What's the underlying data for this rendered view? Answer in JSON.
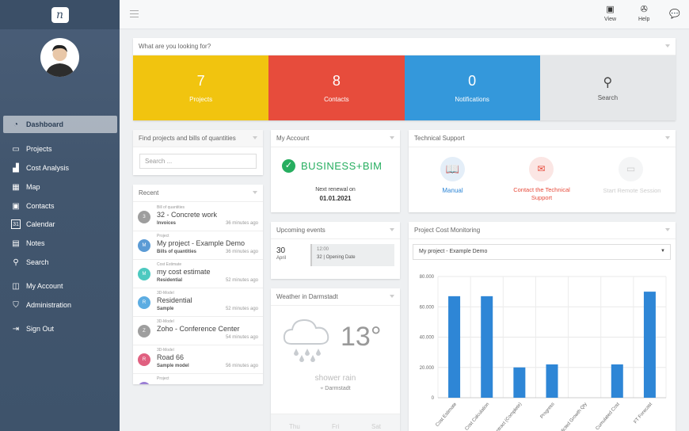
{
  "topbar": {
    "view_label": "View",
    "help_label": "Help"
  },
  "sidebar": {
    "logo": "n",
    "items": [
      {
        "label": "Dashboard",
        "icon": "speedometer-icon",
        "glyph": "◔"
      },
      {
        "label": "Projects",
        "icon": "folder-icon",
        "glyph": "▭"
      },
      {
        "label": "Cost Analysis",
        "icon": "bar-chart-icon",
        "glyph": "▟"
      },
      {
        "label": "Map",
        "icon": "map-icon",
        "glyph": "▦"
      },
      {
        "label": "Contacts",
        "icon": "contacts-icon",
        "glyph": "▣"
      },
      {
        "label": "Calendar",
        "icon": "calendar-icon",
        "glyph": "31"
      },
      {
        "label": "Notes",
        "icon": "notes-icon",
        "glyph": "▤"
      },
      {
        "label": "Search",
        "icon": "search-icon",
        "glyph": "⚲"
      },
      {
        "label": "My Account",
        "icon": "account-icon",
        "glyph": "◫"
      },
      {
        "label": "Administration",
        "icon": "shield-icon",
        "glyph": "⛉"
      },
      {
        "label": "Sign Out",
        "icon": "sign-out-icon",
        "glyph": "⇥"
      }
    ]
  },
  "lookup": {
    "title": "What are you looking for?",
    "tiles": [
      {
        "number": "7",
        "label": "Projects",
        "color": "#f1c40f"
      },
      {
        "number": "8",
        "label": "Contacts",
        "color": "#e74c3c"
      },
      {
        "number": "0",
        "label": "Notifications",
        "color": "#3498db"
      },
      {
        "number": "",
        "label": "Search",
        "color": "#e5e7e9"
      }
    ]
  },
  "find": {
    "title": "Find projects and bills of quantities",
    "placeholder": "Search ..."
  },
  "recent": {
    "title": "Recent",
    "items": [
      {
        "avatar": "3",
        "color": "#9e9e9e",
        "category": "Bill of quantities",
        "title": "32 - Concrete work",
        "sub": "Invoices",
        "time": "36 minutes ago"
      },
      {
        "avatar": "M",
        "color": "#5b9bd5",
        "category": "Project",
        "title": "My project - Example Demo",
        "sub": "Bills of quantities",
        "time": "36 minutes ago"
      },
      {
        "avatar": "M",
        "color": "#4dc9c0",
        "category": "Cost Estimate",
        "title": "my cost estimate",
        "sub": "Residential",
        "time": "52 minutes ago"
      },
      {
        "avatar": "R",
        "color": "#5dade2",
        "category": "3D-Model",
        "title": "Residential",
        "sub": "Sample",
        "time": "52 minutes ago"
      },
      {
        "avatar": "Z",
        "color": "#9e9e9e",
        "category": "3D-Model",
        "title": "Zoho - Conference Center",
        "sub": "",
        "time": "54 minutes ago"
      },
      {
        "avatar": "R",
        "color": "#e06080",
        "category": "3D-Model",
        "title": "Road 66",
        "sub": "Sample model",
        "time": "56 minutes ago"
      },
      {
        "avatar": "",
        "color": "#9b7fd4",
        "category": "Project",
        "title": "",
        "sub": "",
        "time": ""
      }
    ]
  },
  "account": {
    "title": "My Account",
    "plan": "BUSINESS+BIM",
    "renewal_label": "Next renewal on",
    "renewal_date": "01.01.2021"
  },
  "events": {
    "title": "Upcoming events",
    "day": "30",
    "month": "April",
    "time": "12:00",
    "desc": "32 | Opening Date"
  },
  "weather": {
    "title": "Weather in Darmstadt",
    "temp": "13°",
    "desc": "shower rain",
    "location": "Darmstadt",
    "days": [
      "Thu",
      "Fri",
      "Sat"
    ]
  },
  "support": {
    "title": "Technical Support",
    "manual": "Manual",
    "contact_line1": "Contact the Technical",
    "contact_line2": "Support",
    "remote": "Start Remote Session"
  },
  "cost": {
    "title": "Project Cost Monitoring",
    "selected": "My project - Example Demo"
  },
  "chart_data": {
    "type": "bar",
    "categories": [
      "Cost Estimate",
      "Cost Calculation",
      "Contract (Complete)",
      "Progress",
      "Predicted Growth Qty",
      "Cumulated Cost",
      "FT Forecast"
    ],
    "values": [
      67000,
      67000,
      20000,
      22000,
      0,
      22000,
      70000
    ],
    "ylim": [
      0,
      80000
    ],
    "yticks": [
      "0",
      "20.000",
      "40.000",
      "60.000",
      "80.000"
    ],
    "grid": true,
    "color": "#2e86d6"
  }
}
